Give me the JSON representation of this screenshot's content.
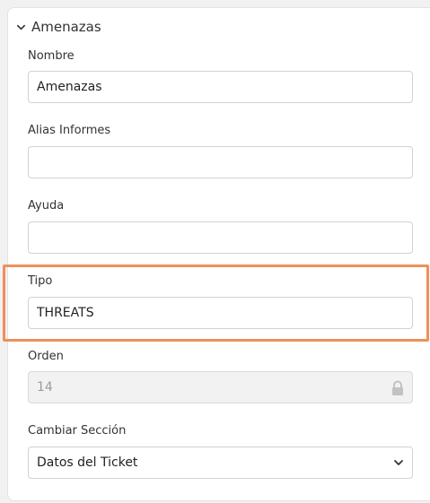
{
  "section": {
    "title": "Amenazas",
    "toggle_icon": "chevron-down-icon"
  },
  "fields": {
    "nombre": {
      "label": "Nombre",
      "value": "Amenazas"
    },
    "alias": {
      "label": "Alias Informes",
      "value": ""
    },
    "ayuda": {
      "label": "Ayuda",
      "value": ""
    },
    "tipo": {
      "label": "Tipo",
      "value": "THREATS"
    },
    "orden": {
      "label": "Orden",
      "value": "14",
      "icon": "lock-icon"
    },
    "cambiar_seccion": {
      "label": "Cambiar Sección",
      "value": "Datos del Ticket",
      "icon": "chevron-down-icon"
    }
  },
  "highlight_color": "#ee9058"
}
